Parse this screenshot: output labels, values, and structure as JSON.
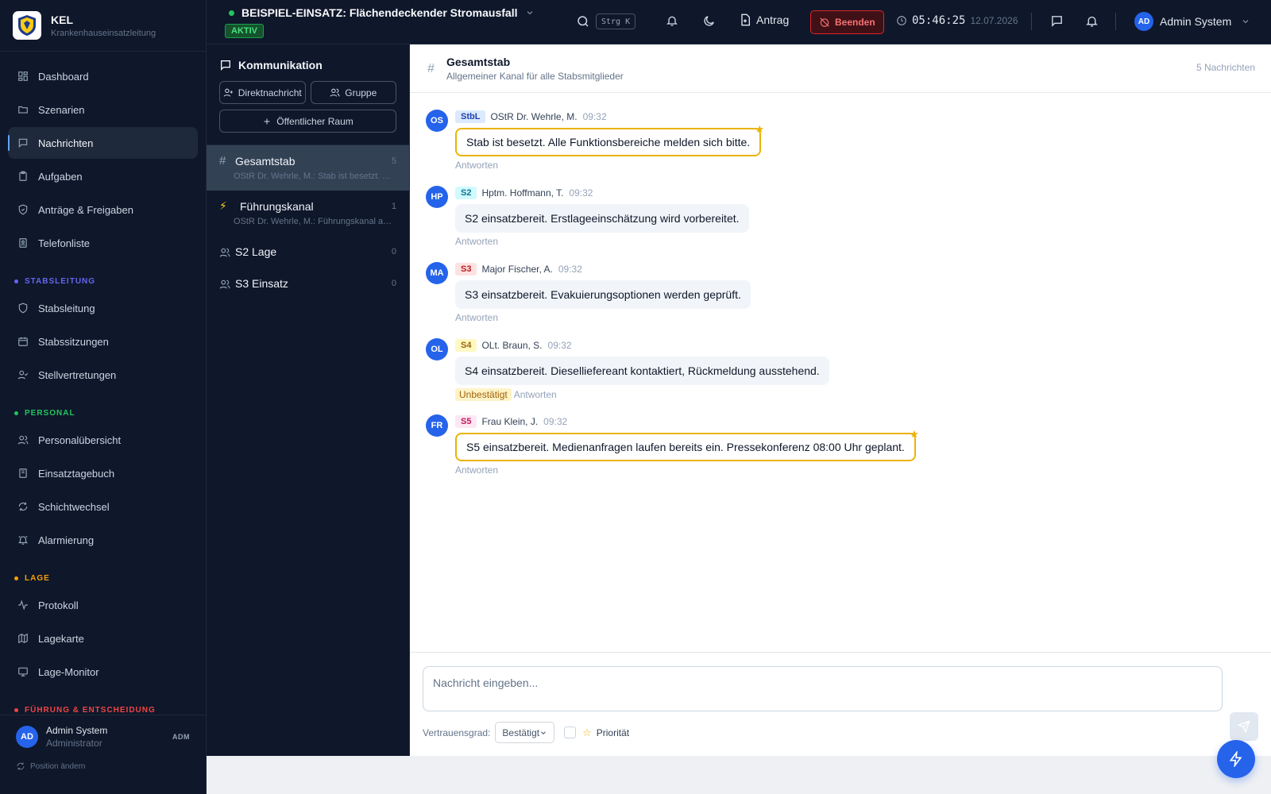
{
  "brand": {
    "title": "KEL",
    "subtitle": "Krankenhauseinsatzleitung"
  },
  "nav": {
    "top": [
      {
        "label": "Dashboard",
        "icon": "dashboard-icon"
      },
      {
        "label": "Szenarien",
        "icon": "folder-icon"
      },
      {
        "label": "Nachrichten",
        "icon": "message-icon",
        "active": true
      },
      {
        "label": "Aufgaben",
        "icon": "clipboard-icon"
      },
      {
        "label": "Anträge & Freigaben",
        "icon": "shield-check-icon"
      },
      {
        "label": "Telefonliste",
        "icon": "contact-book-icon"
      }
    ],
    "sections": [
      {
        "title": "STABSLEITUNG",
        "color": "#6366f1",
        "items": [
          {
            "label": "Stabsleitung",
            "icon": "shield-icon"
          },
          {
            "label": "Stabssitzungen",
            "icon": "calendar-icon"
          },
          {
            "label": "Stellvertretungen",
            "icon": "user-check-icon"
          }
        ]
      },
      {
        "title": "PERSONAL",
        "color": "#22c55e",
        "items": [
          {
            "label": "Personalübersicht",
            "icon": "users-icon"
          },
          {
            "label": "Einsatztagebuch",
            "icon": "book-icon"
          },
          {
            "label": "Schichtwechsel",
            "icon": "refresh-icon"
          },
          {
            "label": "Alarmierung",
            "icon": "alarm-bell-icon"
          }
        ]
      },
      {
        "title": "LAGE",
        "color": "#f59e0b",
        "items": [
          {
            "label": "Protokoll",
            "icon": "activity-icon"
          },
          {
            "label": "Lagekarte",
            "icon": "map-icon"
          },
          {
            "label": "Lage-Monitor",
            "icon": "monitor-icon"
          }
        ]
      },
      {
        "title": "FÜHRUNG & ENTSCHEIDUNG",
        "color": "#ef4444",
        "items": []
      }
    ]
  },
  "sidebar_user": {
    "initials": "AD",
    "name": "Admin System",
    "role": "Administrator",
    "tag": "ADM",
    "position_change": "Position ändern"
  },
  "topbar": {
    "incident_title": "BEISPIEL-EINSATZ: Flächendeckender Stromausfall",
    "status": "AKTIV",
    "shortcut": "Strg K",
    "antrag": "Antrag",
    "beenden": "Beenden",
    "time": "05:46:25",
    "date": "12.07.2026",
    "user_initials": "AD",
    "user_name": "Admin System"
  },
  "communication": {
    "title": "Kommunikation",
    "btn_direct": "Direktnachricht",
    "btn_group": "Gruppe",
    "btn_public": "Öffentlicher Raum",
    "channels": [
      {
        "name": "Gesamtstab",
        "preview": "OStR Dr. Wehrle, M.: Stab ist besetzt. Alle Funktionsbereiche melden sich bitte.",
        "count": "5",
        "icon": "hash-icon",
        "active": true
      },
      {
        "name": "Führungskanal",
        "preview": "OStR Dr. Wehrle, M.: Führungskanal aktiv.",
        "count": "1",
        "icon": "lightning-icon"
      },
      {
        "name": "S2 Lage",
        "preview": "",
        "count": "0",
        "icon": "users-icon"
      },
      {
        "name": "S3 Einsatz",
        "preview": "",
        "count": "0",
        "icon": "users-icon"
      }
    ]
  },
  "chat": {
    "title": "Gesamtstab",
    "subtitle": "Allgemeiner Kanal für alle Stabsmitglieder",
    "count": "5 Nachrichten",
    "reply_label": "Antworten",
    "messages": [
      {
        "initials": "OS",
        "role": "StbL",
        "role_bg": "#dbeafe",
        "role_fg": "#1e40af",
        "sender": "OStR Dr. Wehrle, M.",
        "time": "09:32",
        "text": "Stab ist besetzt. Alle Funktionsbereiche melden sich bitte.",
        "priority": true,
        "unconfirmed": ""
      },
      {
        "initials": "HP",
        "role": "S2",
        "role_bg": "#cffafe",
        "role_fg": "#0e7490",
        "sender": "Hptm. Hoffmann, T.",
        "time": "09:32",
        "text": "S2 einsatzbereit. Erstlageeinschätzung wird vorbereitet.",
        "priority": false,
        "unconfirmed": ""
      },
      {
        "initials": "MA",
        "role": "S3",
        "role_bg": "#fee2e2",
        "role_fg": "#b91c1c",
        "sender": "Major Fischer, A.",
        "time": "09:32",
        "text": "S3 einsatzbereit. Evakuierungsoptionen werden geprüft.",
        "priority": false,
        "unconfirmed": ""
      },
      {
        "initials": "OL",
        "role": "S4",
        "role_bg": "#fef9c3",
        "role_fg": "#a16207",
        "sender": "OLt. Braun, S.",
        "time": "09:32",
        "text": "S4 einsatzbereit. Dieselliefereant kontaktiert, Rückmeldung ausstehend.",
        "priority": false,
        "unconfirmed": "Unbestätigt"
      },
      {
        "initials": "FR",
        "role": "S5",
        "role_bg": "#fce7f3",
        "role_fg": "#be185d",
        "sender": "Frau Klein, J.",
        "time": "09:32",
        "text": "S5 einsatzbereit. Medienanfragen laufen bereits ein. Pressekonferenz 08:00 Uhr geplant.",
        "priority": true,
        "unconfirmed": ""
      }
    ]
  },
  "composer": {
    "placeholder": "Nachricht eingeben...",
    "confidence_label": "Vertrauensgrad:",
    "confidence_value": "Bestätigt",
    "priority_label": "Priorität"
  }
}
